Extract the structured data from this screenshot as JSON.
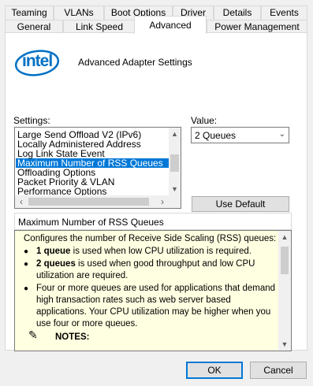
{
  "tabs_row1": [
    "Teaming",
    "VLANs",
    "Boot Options",
    "Driver",
    "Details",
    "Events"
  ],
  "tabs_row2": [
    "General",
    "Link Speed",
    "Advanced",
    "Power Management"
  ],
  "active_tab": "Advanced",
  "header": {
    "logo_text": "intel",
    "title": "Advanced Adapter Settings"
  },
  "settings": {
    "label": "Settings:",
    "items": [
      "Large Send Offload V2 (IPv6)",
      "Locally Administered Address",
      "Log Link State Event",
      "Maximum Number of RSS Queues",
      "Offloading Options",
      "Packet Priority & VLAN",
      "Performance Options"
    ],
    "selected_index": 3
  },
  "value": {
    "label": "Value:",
    "selected": "2 Queues"
  },
  "use_default_label": "Use Default",
  "help": {
    "title": "Maximum Number of RSS Queues",
    "intro": "Configures the number of Receive Side Scaling (RSS) queues:",
    "b1_bold": "1 queue",
    "b1_text": " is used when low CPU utilization is required.",
    "b2_bold": "2 queues",
    "b2_text": " is used when good throughput and low CPU utilization are required.",
    "b3_text": "Four or more queues are used for applications that demand high transaction rates such as web server based applications. Your CPU utilization may be higher when you use four or more queues.",
    "notes": "NOTES:"
  },
  "buttons": {
    "ok": "OK",
    "cancel": "Cancel"
  },
  "colors": {
    "selection": "#0078d7",
    "help_bg": "#ffffe1",
    "intel_blue": "#0071c5"
  }
}
